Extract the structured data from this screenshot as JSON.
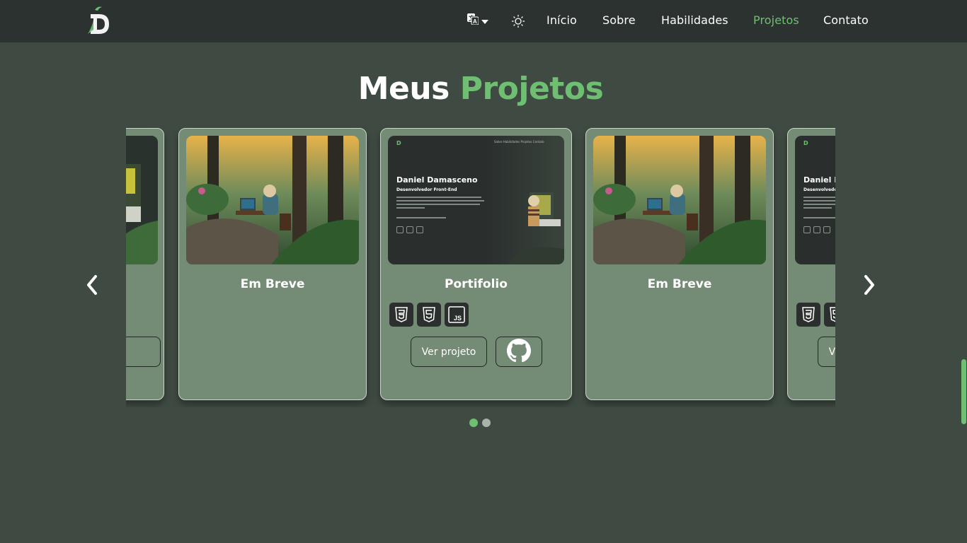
{
  "header": {
    "logo_letter": "D",
    "nav": [
      "Início",
      "Sobre",
      "Habilidades",
      "Projetos",
      "Contato"
    ],
    "active": "Projetos"
  },
  "section": {
    "title_white": "Meus",
    "title_green": "Projetos"
  },
  "cards": [
    {
      "title": "Em Breve"
    },
    {
      "title": "Portifolio",
      "tech": [
        "css3-icon",
        "html5-icon",
        "js-icon"
      ],
      "view_label": "Ver projeto"
    },
    {
      "title": "Em Breve"
    }
  ],
  "preview": {
    "name": "Daniel Damasceno",
    "role": "Desenvolvedor Front-End",
    "nav": "Sobre  Habilidades  Projetos  Contato"
  },
  "colors": {
    "accent": "#6fbf73",
    "card": "#748b75",
    "bg": "#3f4b42",
    "header": "#2b3230"
  },
  "carousel": {
    "pages": 2,
    "current_page": 1
  }
}
